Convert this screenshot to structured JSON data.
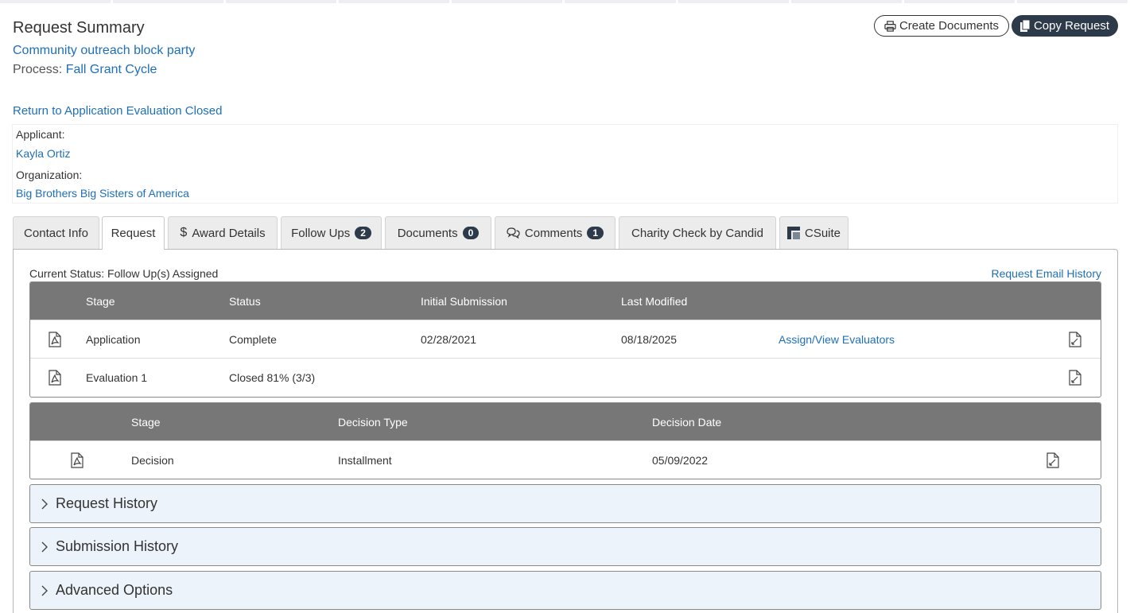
{
  "header": {
    "title": "Request Summary",
    "request_name": "Community outreach block party",
    "process_label": "Process:",
    "process_name": "Fall Grant Cycle",
    "return_link": "Return to Application Evaluation Closed",
    "create_documents": "Create Documents",
    "copy_request": "Copy Request"
  },
  "applicant": {
    "applicant_label": "Applicant:",
    "applicant_name": "Kayla Ortiz",
    "organization_label": "Organization:",
    "organization_name": "Big Brothers Big Sisters of America"
  },
  "tabs": [
    {
      "label": "Contact Info"
    },
    {
      "label": "Request",
      "active": true
    },
    {
      "label": "Award Details",
      "icon": "dollar-icon"
    },
    {
      "label": "Follow Ups",
      "badge": "2"
    },
    {
      "label": "Documents",
      "badge": "0"
    },
    {
      "label": "Comments",
      "badge": "1",
      "icon": "comments-icon"
    },
    {
      "label": "Charity Check by Candid"
    },
    {
      "label": "CSuite",
      "icon": "csuite-logo-icon"
    }
  ],
  "request": {
    "current_status": "Current Status: Follow Up(s) Assigned",
    "email_history": "Request Email History",
    "stages_table": {
      "headers": [
        "Stage",
        "Status",
        "Initial Submission",
        "Last Modified"
      ],
      "rows": [
        {
          "stage": "Application",
          "status": "Complete",
          "initial": "02/28/2021",
          "modified": "08/18/2025",
          "action": "Assign/View Evaluators"
        },
        {
          "stage": "Evaluation 1",
          "status": "Closed 81% (3/3)",
          "initial": "",
          "modified": "",
          "action": ""
        }
      ]
    },
    "decision_table": {
      "headers": [
        "Stage",
        "Decision Type",
        "Decision Date"
      ],
      "rows": [
        {
          "stage": "Decision",
          "type": "Installment",
          "date": "05/09/2022"
        }
      ]
    },
    "sections": [
      "Request History",
      "Submission History",
      "Advanced Options"
    ]
  },
  "colors": {
    "link": "#1f6fb8",
    "table_header": "#777777",
    "accordion_bg": "#edf3fb",
    "dark_button": "#2d3a4a"
  }
}
